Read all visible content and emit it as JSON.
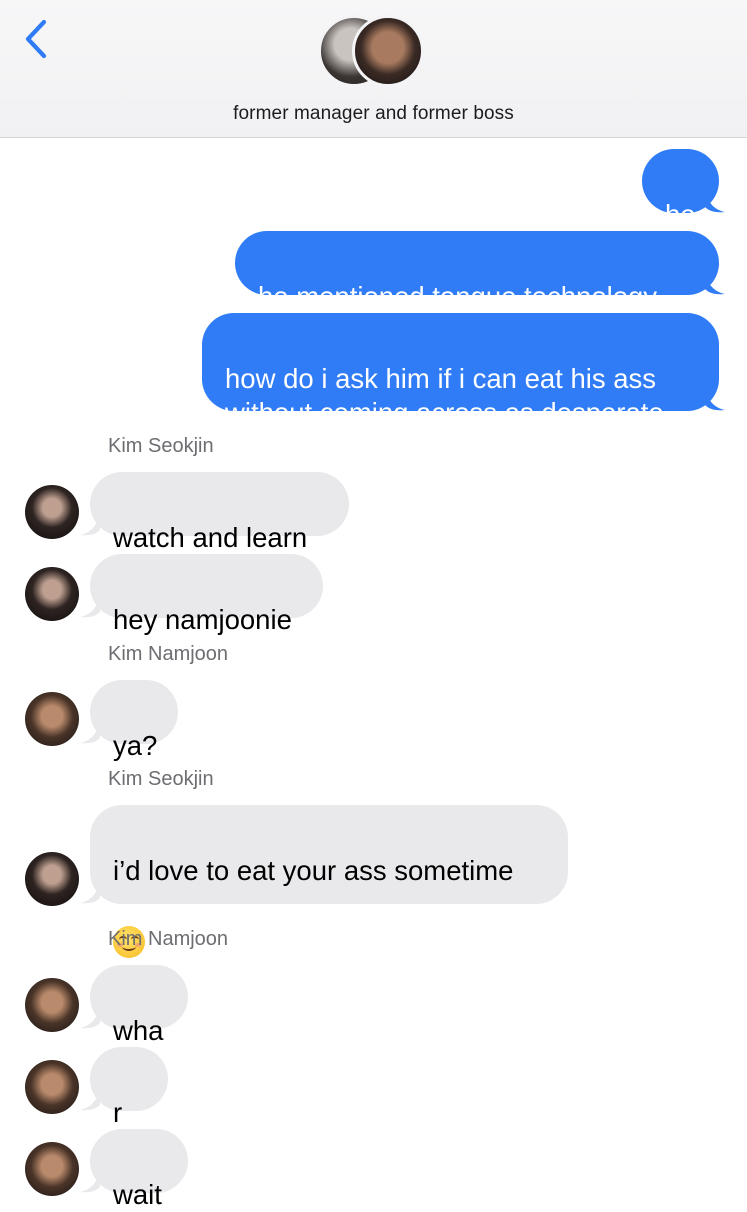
{
  "header": {
    "title": "former manager and former boss",
    "back_icon": "chevron-left-icon",
    "accent_color": "#2f7cf6"
  },
  "messages": [
    {
      "type": "sent",
      "text": "he"
    },
    {
      "type": "sent",
      "text": "he mentioned tongue technology"
    },
    {
      "type": "sent",
      "text": "how do i ask him if i can eat his ass\nwithout coming across as desperate"
    },
    {
      "type": "sender",
      "text": "Kim Seokjin"
    },
    {
      "type": "received",
      "text": "watch and learn"
    },
    {
      "type": "received",
      "text": "hey namjoonie"
    },
    {
      "type": "sender",
      "text": "Kim Namjoon"
    },
    {
      "type": "received",
      "text": "ya?"
    },
    {
      "type": "sender",
      "text": "Kim Seokjin"
    },
    {
      "type": "received",
      "text": "i’d love to eat your ass sometime",
      "emoji": "smiling-face-icon"
    },
    {
      "type": "sender",
      "text": "Kim Namjoon"
    },
    {
      "type": "received",
      "text": "wha"
    },
    {
      "type": "received",
      "text": "r u"
    },
    {
      "type": "received",
      "text": "wait"
    }
  ],
  "colors": {
    "sent_bubble": "#2f7cf6",
    "received_bubble": "#e9e9eb"
  }
}
